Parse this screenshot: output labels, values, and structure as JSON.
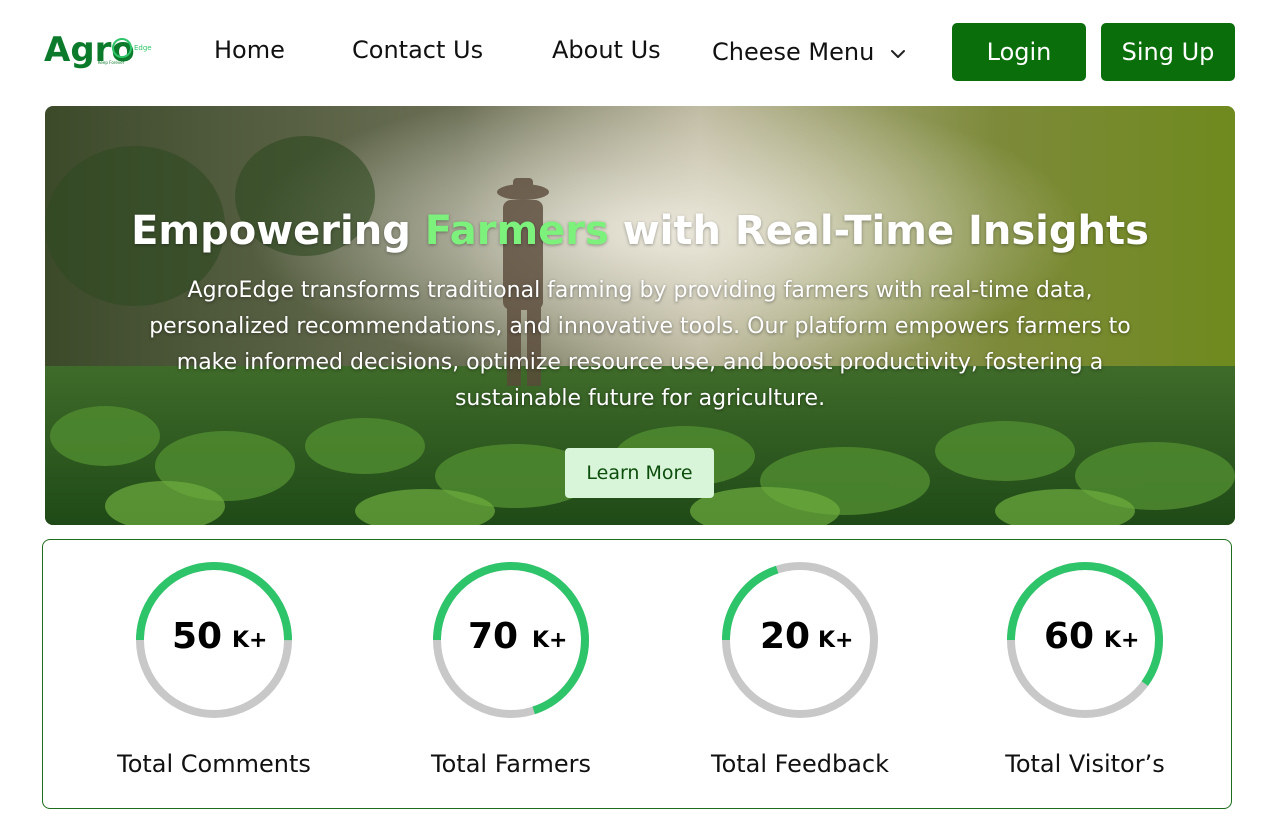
{
  "header": {
    "logo_text": "Agro",
    "logo_sub": "Edge",
    "logo_tagline": "Keep Forever",
    "nav": {
      "home": "Home",
      "contact": "Contact Us",
      "about": "About Us",
      "menu": "Cheese Menu"
    },
    "login": "Login",
    "signup": "Sing Up"
  },
  "hero": {
    "title_pre": "Empowering ",
    "title_highlight": "Farmers",
    "title_post": " with Real-Time Insights",
    "description": "AgroEdge transforms traditional farming by providing farmers with real-time data, personalized recommendations, and innovative tools. Our platform empowers farmers to make informed decisions, optimize resource use, and boost productivity, fostering a sustainable future for agriculture.",
    "cta": "Learn More"
  },
  "stats": [
    {
      "value": "50",
      "suffix": "K+",
      "label": "Total Comments",
      "progress": 0.5
    },
    {
      "value": "70",
      "suffix": "K+",
      "label": "Total Farmers",
      "progress": 0.7
    },
    {
      "value": "20",
      "suffix": "K+",
      "label": "Total Feedback",
      "progress": 0.2
    },
    {
      "value": "60",
      "suffix": "K+",
      "label": "Total Visitor’s",
      "progress": 0.6
    }
  ],
  "colors": {
    "brand_green": "#0a6e0a",
    "ring_progress": "#2ec46a",
    "ring_track": "#c8c8c8",
    "highlight": "#7cf27c"
  }
}
